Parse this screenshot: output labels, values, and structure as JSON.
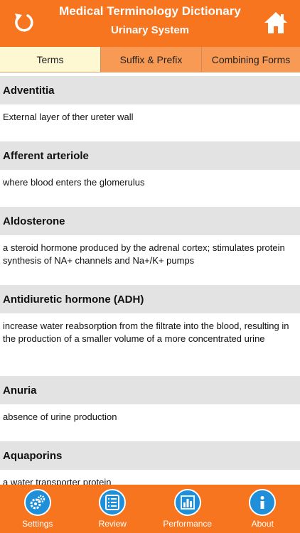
{
  "header": {
    "title": "Medical Terminology Dictionary",
    "subtitle": "Urinary System",
    "back_icon": "refresh-icon",
    "home_icon": "home-icon"
  },
  "tabs": [
    {
      "label": "Terms",
      "active": true
    },
    {
      "label": "Suffix & Prefix",
      "active": false
    },
    {
      "label": "Combining Forms",
      "active": false
    }
  ],
  "terms": [
    {
      "term": "Adventitia",
      "definition": "External layer of ther ureter wall"
    },
    {
      "term": "Afferent arteriole",
      "definition": "where blood enters the glomerulus"
    },
    {
      "term": "Aldosterone",
      "definition": "a steroid hormone produced by the adrenal cortex; stimulates protein synthesis of NA+ channels and Na+/K+ pumps"
    },
    {
      "term": "Antidiuretic hormone (ADH)",
      "definition": "increase water reabsorption from the filtrate into the blood, resulting in the production of a smaller volume of a more concentrated urine"
    },
    {
      "term": "Anuria",
      "definition": "absence of urine production"
    },
    {
      "term": "Aquaporins",
      "definition": "a water transporter protein"
    }
  ],
  "bottom_nav": [
    {
      "label": "Settings",
      "icon": "gears-icon"
    },
    {
      "label": "Review",
      "icon": "list-icon"
    },
    {
      "label": "Performance",
      "icon": "bar-chart-icon"
    },
    {
      "label": "About",
      "icon": "info-icon"
    }
  ],
  "colors": {
    "accent": "#f7751f",
    "tab_active": "#fdf8d2",
    "tab_inactive": "#f99a54",
    "icon_blue": "#1e8fd8"
  }
}
